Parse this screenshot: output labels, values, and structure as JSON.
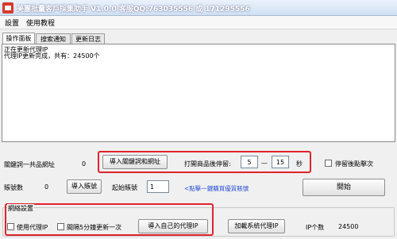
{
  "window": {
    "title": "美團批量客戶採集助手 V1.0.0 客服QQ:763035556 或 171295556"
  },
  "menu": {
    "items": [
      "設置",
      "使用教程"
    ]
  },
  "tabs": [
    {
      "label": "操作面板",
      "active": true
    },
    {
      "label": "搜索通知",
      "active": false
    },
    {
      "label": "更新日志",
      "active": false
    }
  ],
  "log": {
    "lines": [
      "正在更新代理IP",
      "代理IP更新完成，共有：24500个"
    ]
  },
  "keyword_row": {
    "label": "關鍵詞一共品網址",
    "count": "0",
    "import_button": "導入關鍵詞和網址",
    "open_wait_label": "打開商品後停留:",
    "wait_min": "5",
    "dash": "—",
    "wait_max": "15",
    "unit": "秒",
    "resume_label": "停留後點擊次"
  },
  "account_row": {
    "label": "賬號數",
    "count": "0",
    "import_button": "導入賬號",
    "start_label": "起始賬號",
    "start_value": "1",
    "link_text": "<點擊一鍵購買優質賬號",
    "start_button": "開始"
  },
  "network": {
    "group_label": "網絡設置",
    "use_proxy_label": "使用代理IP",
    "auto_refresh_label": "間隔5分鐘更新一次",
    "import_proxy_button": "導入自己的代理IP",
    "load_system_proxy_button": "加載系統代理IP",
    "ip_count_label": "IP个数",
    "ip_count_value": "24500"
  }
}
